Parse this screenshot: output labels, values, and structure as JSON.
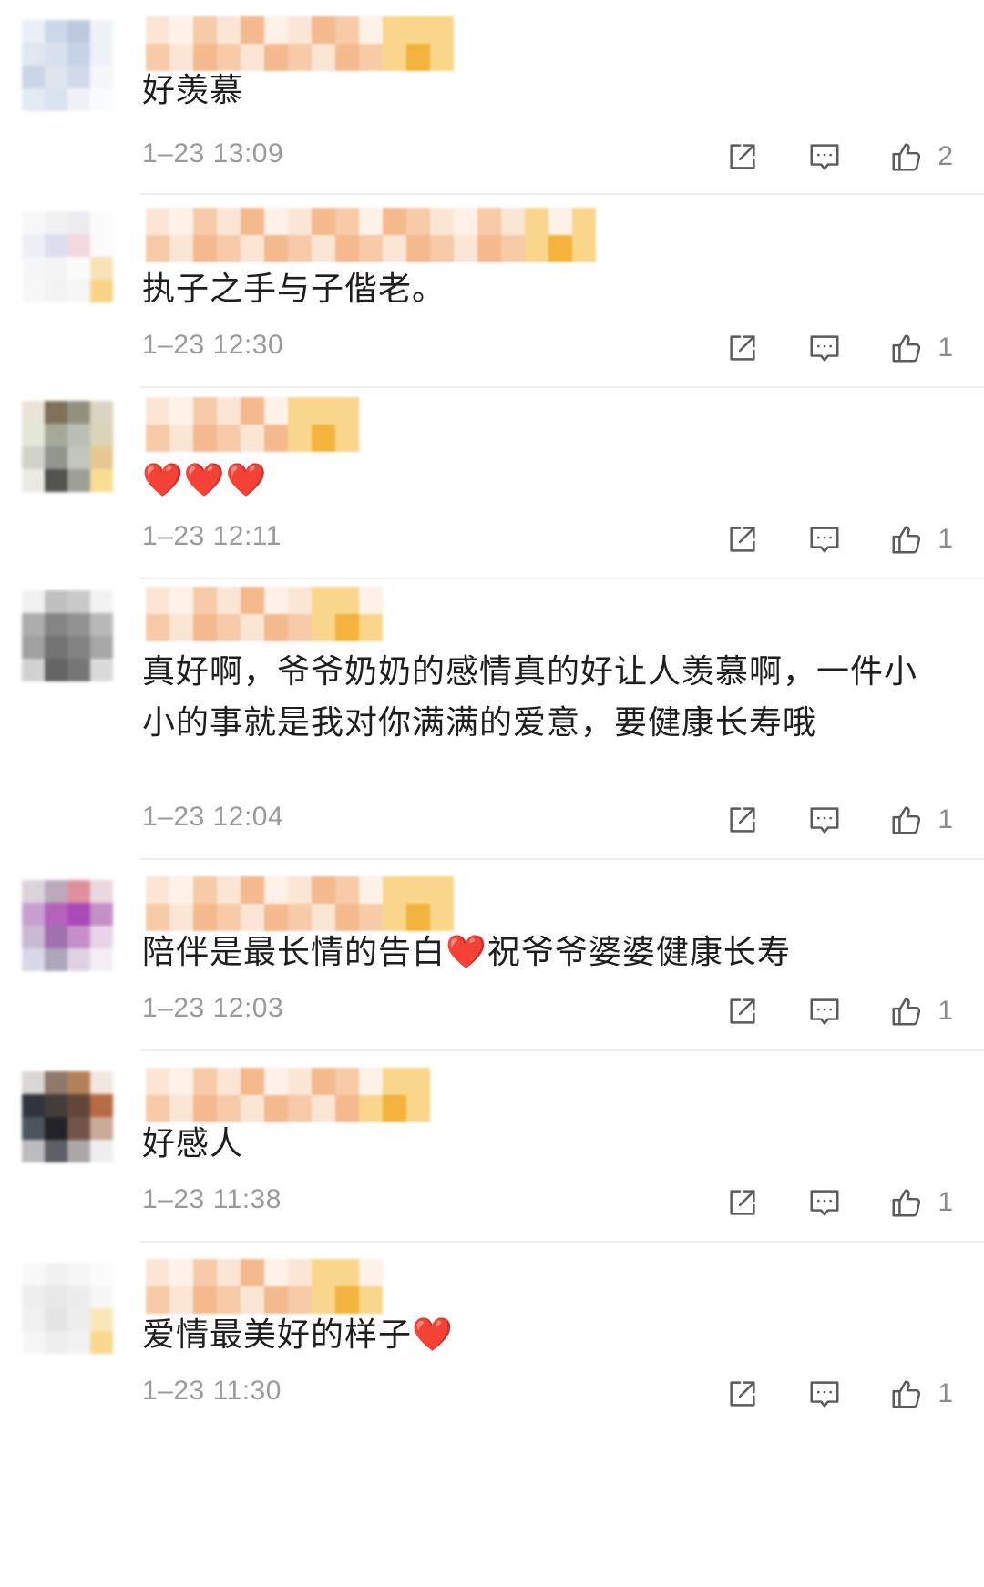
{
  "comments": [
    {
      "text": "好羡慕",
      "time": "1–23 13:09",
      "likes": "2"
    },
    {
      "text": "执子之手与子偕老。",
      "time": "1–23 12:30",
      "likes": "1"
    },
    {
      "text": "❤️❤️❤️",
      "time": "1–23 12:11",
      "likes": "1"
    },
    {
      "text": "真好啊，爷爷奶奶的感情真的好让人羡慕啊，一件小小的事就是我对你满满的爱意，要健康长寿哦",
      "time": "1–23 12:04",
      "likes": "1"
    },
    {
      "text": "陪伴是最长情的告白❤️祝爷爷婆婆健康长寿",
      "time": "1–23 12:03",
      "likes": "1"
    },
    {
      "text": "好感人",
      "time": "1–23 11:38",
      "likes": "1"
    },
    {
      "text": "爱情最美好的样子❤️",
      "time": "1–23 11:30",
      "likes": "1"
    }
  ],
  "icons": {
    "share": "share-icon",
    "reply": "comment-icon",
    "like": "thumbs-up-icon"
  },
  "colors": {
    "heart": "#e4161d",
    "meta_text": "#9a9a9a",
    "divider": "#eeeeee",
    "username_blur_primary": "#f5b98e",
    "username_blur_accent": "#f3b33c"
  }
}
